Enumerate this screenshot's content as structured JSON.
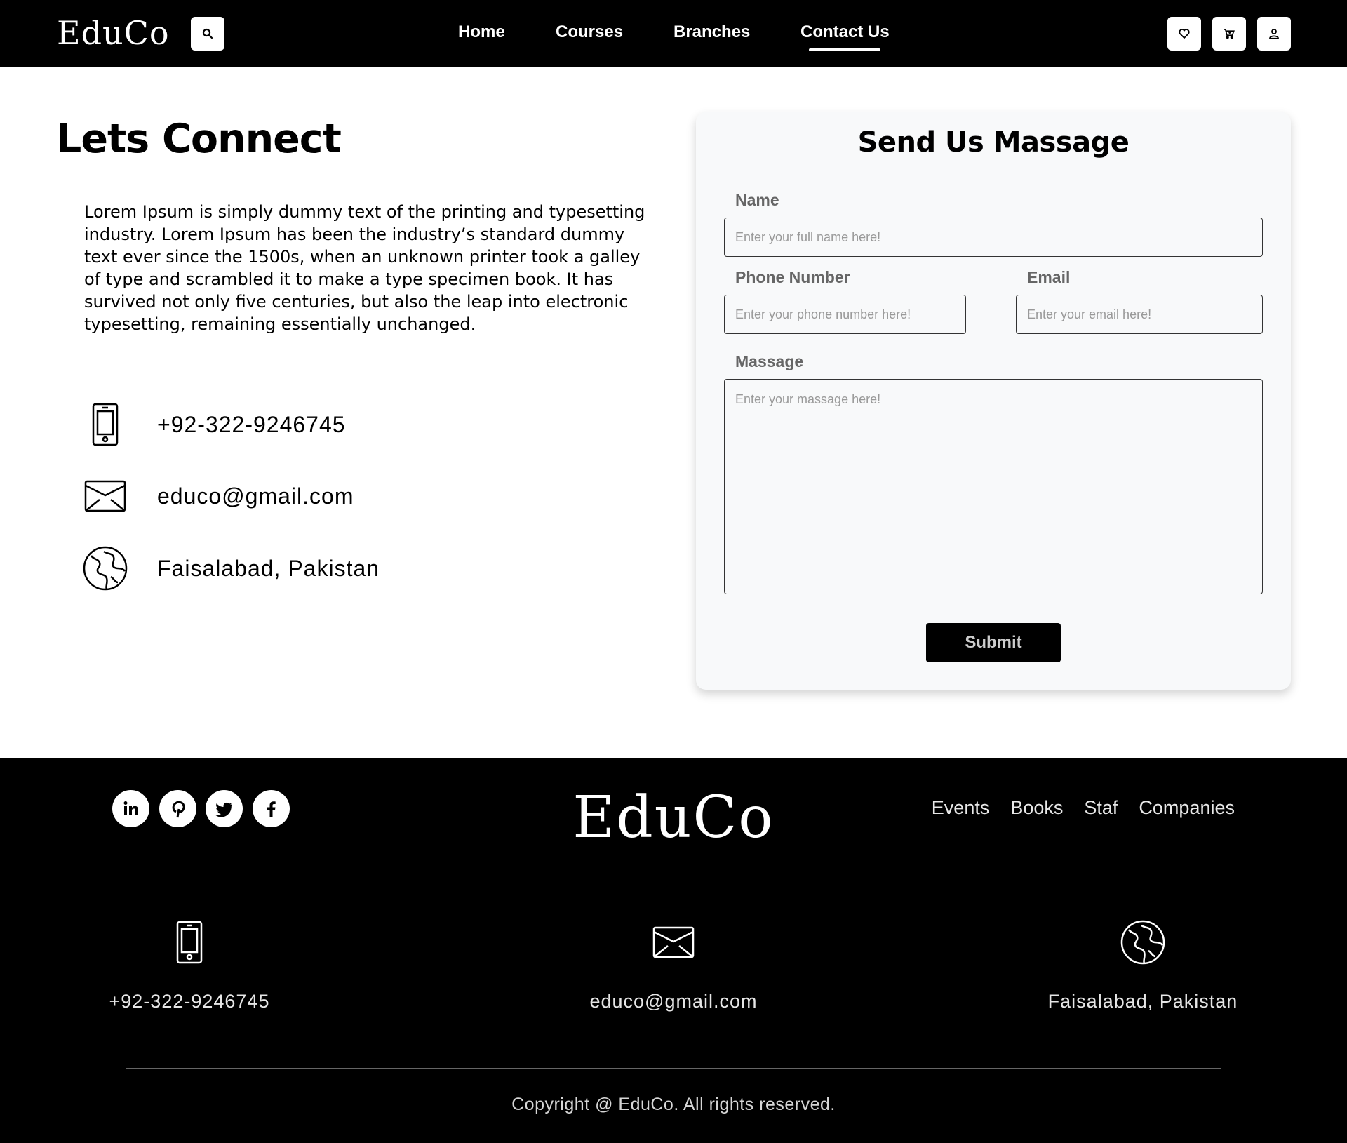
{
  "header": {
    "brand": "EduCo",
    "nav": [
      "Home",
      "Courses",
      "Branches",
      "Contact Us"
    ],
    "active_nav": "Contact Us",
    "icons": [
      "search-icon",
      "heart-icon",
      "cart-icon",
      "user-icon"
    ]
  },
  "intro": {
    "title": "Lets Connect",
    "paragraph": "Lorem Ipsum is simply dummy text of the printing and typesetting industry. Lorem Ipsum has been the industry’s standard dummy text ever since the 1500s, when an unknown printer took a galley of type and scrambled it to make a type specimen book. It has survived not only five centuries, but also the leap into electronic typesetting, remaining essentially unchanged.",
    "phone": "+92-322-9246745",
    "email": "educo@gmail.com",
    "location": "Faisalabad, Pakistan"
  },
  "form": {
    "title": "Send Us Massage",
    "name_label": "Name",
    "name_placeholder": "Enter your full name here!",
    "phone_label": "Phone Number",
    "phone_placeholder": "Enter your phone number here!",
    "email_label": "Email",
    "email_placeholder": "Enter your email here!",
    "message_label": "Massage",
    "message_placeholder": "Enter your massage here!",
    "submit_label": "Submit"
  },
  "footer": {
    "brand": "EduCo",
    "social": [
      "linkedin-icon",
      "pinterest-icon",
      "twitter-icon",
      "facebook-icon"
    ],
    "links": [
      "Events",
      "Books",
      "Staf",
      "Companies"
    ],
    "phone": "+92-322-9246745",
    "email": "educo@gmail.com",
    "location": "Faisalabad, Pakistan",
    "copyright": "Copyright @ EduCo. All rights reserved."
  },
  "colors": {
    "header_bg": "#000000",
    "card_bg": "#f8f9fa",
    "label": "#666666",
    "footer_bg": "#000000"
  }
}
